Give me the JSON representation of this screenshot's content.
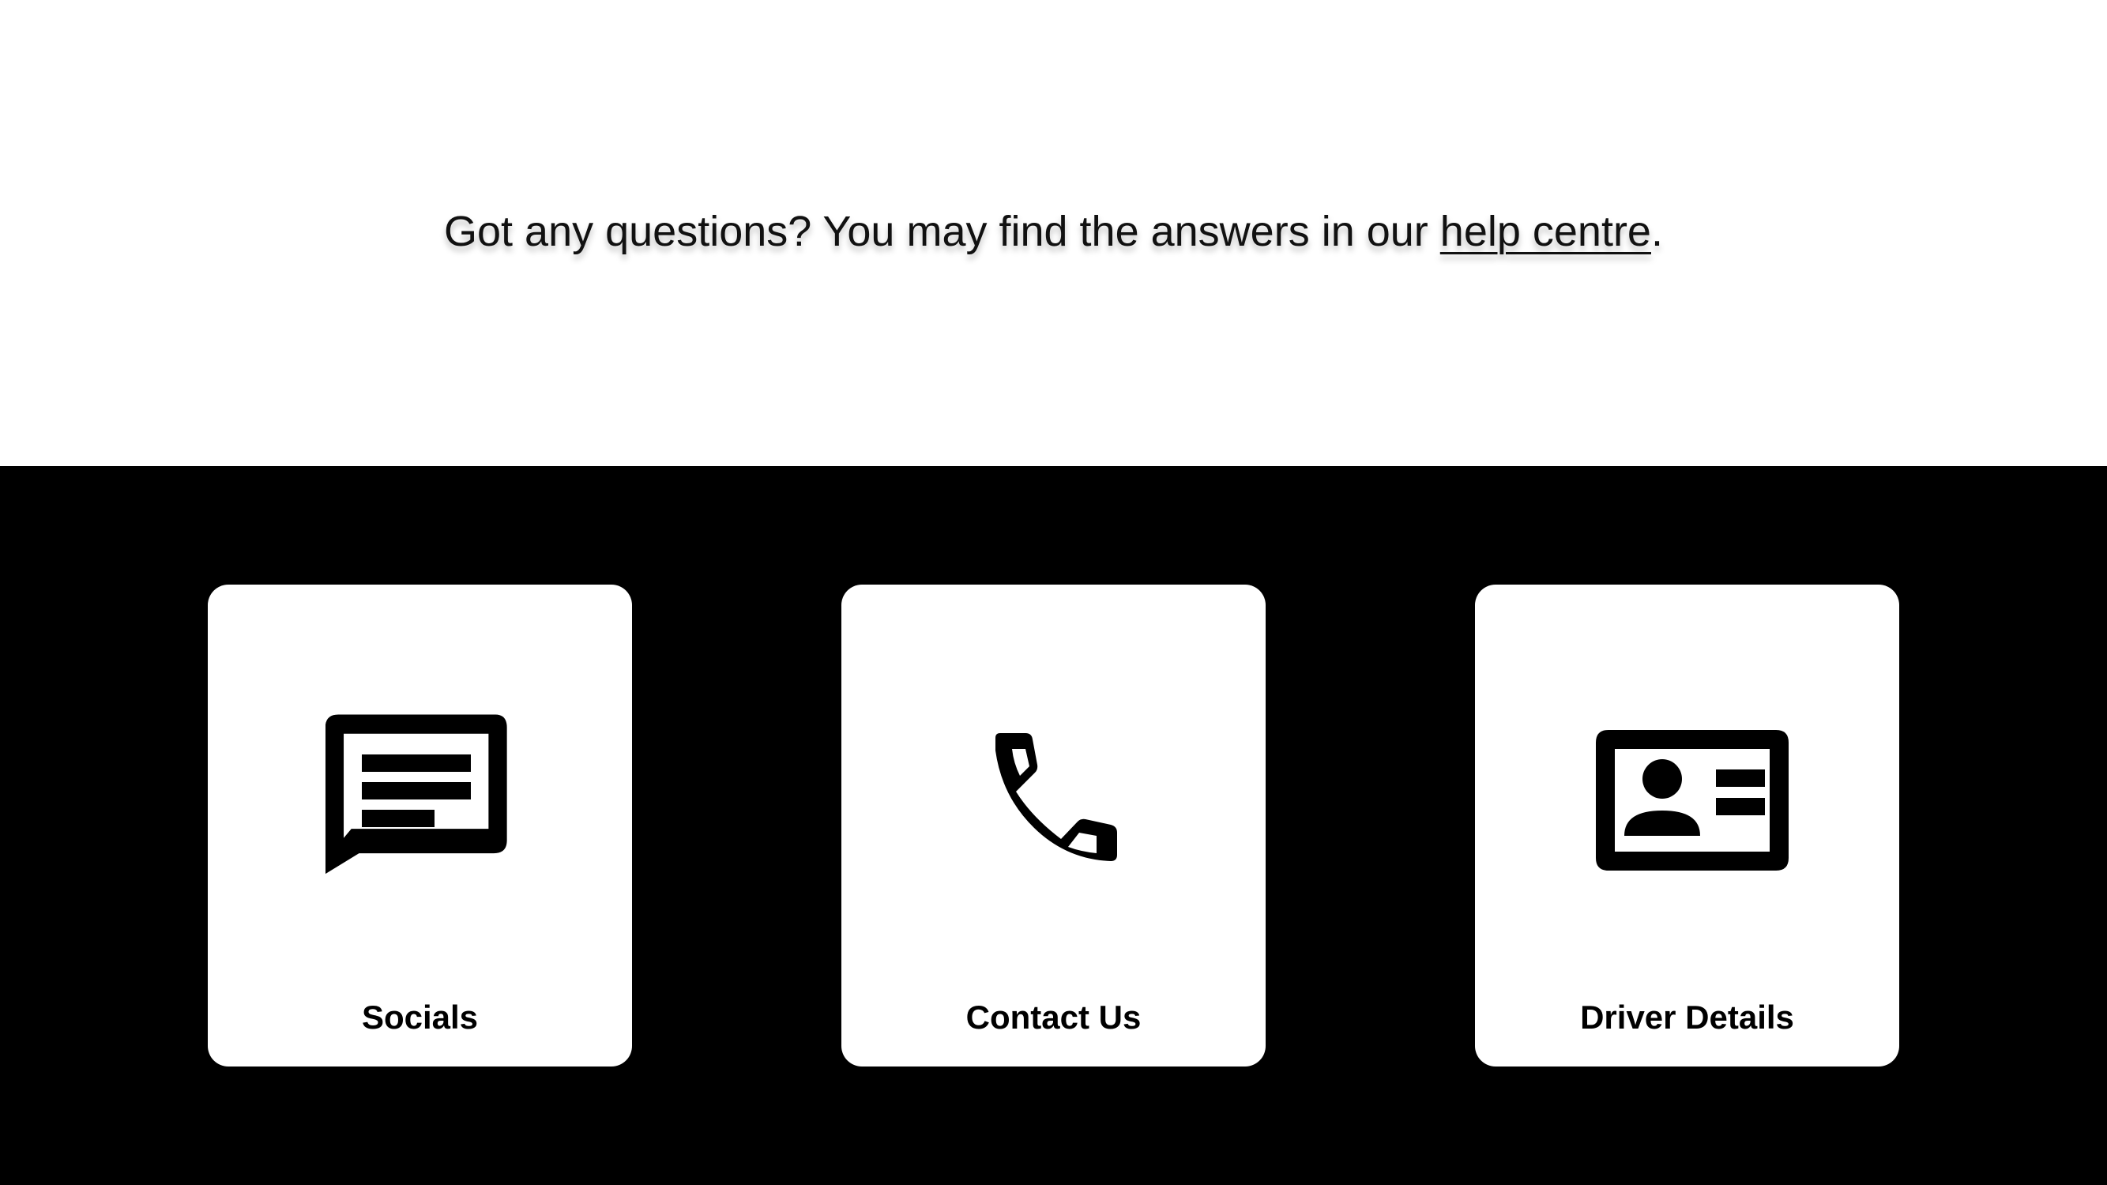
{
  "intro": {
    "text_before": "Got any questions? You may find the answers in our ",
    "link_label": "help centre",
    "text_after": "."
  },
  "cards": [
    {
      "label": "Socials",
      "icon": "chat-message-icon"
    },
    {
      "label": "Contact Us",
      "icon": "phone-icon"
    },
    {
      "label": "Driver Details",
      "icon": "id-card-icon"
    }
  ],
  "colors": {
    "background_top": "#ffffff",
    "background_bottom": "#000000",
    "card": "#ffffff",
    "text": "#000000"
  }
}
